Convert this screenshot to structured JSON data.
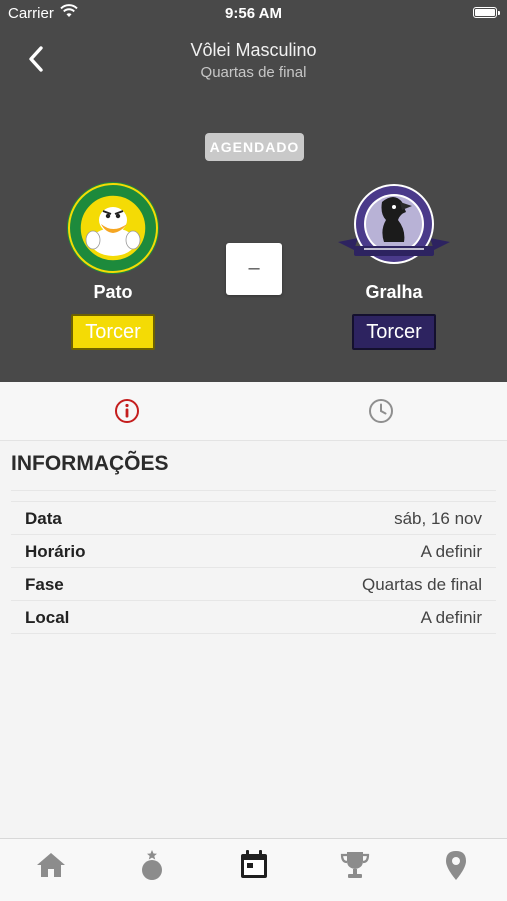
{
  "status_bar": {
    "carrier": "Carrier",
    "time": "9:56 AM"
  },
  "header": {
    "title": "Vôlei Masculino",
    "subtitle": "Quartas de final",
    "status": "AGENDADO",
    "score": "–"
  },
  "teams": {
    "home": {
      "name": "Pato",
      "cheer_label": "Torcer",
      "color": "#f4db05"
    },
    "away": {
      "name": "Gralha",
      "cheer_label": "Torcer",
      "color": "#2d2360"
    }
  },
  "tabs": {
    "info_icon": "info-icon",
    "history_icon": "clock-icon",
    "active": "info",
    "active_color": "#c41d1d"
  },
  "info": {
    "title": "INFORMAÇÕES",
    "rows": [
      {
        "label": "Data",
        "value": "sáb, 16 nov"
      },
      {
        "label": "Horário",
        "value": "A definir"
      },
      {
        "label": "Fase",
        "value": "Quartas de final"
      },
      {
        "label": "Local",
        "value": "A definir"
      }
    ]
  },
  "tab_bar": {
    "items": [
      "home-icon",
      "medal-icon",
      "calendar-icon",
      "trophy-icon",
      "location-icon"
    ],
    "active": "calendar-icon"
  }
}
